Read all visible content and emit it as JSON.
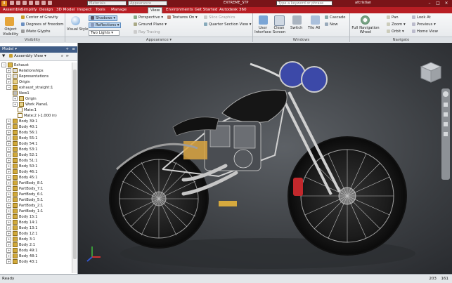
{
  "title_bar": {
    "project_combo": "Materials",
    "appearance_combo": "Appearance",
    "document": "EXTREME_STP",
    "search_placeholder": "Type a keyword or phrase",
    "user": "afcristian"
  },
  "tabs": [
    "Assemble",
    "Simplify",
    "Design",
    "3D Model",
    "Inspect",
    "Tools",
    "Manage",
    "View",
    "Environments",
    "Get Started",
    "Autodesk 360"
  ],
  "active_tab": "View",
  "ribbon": {
    "visibility": {
      "object_visibility": "Object Visibility",
      "center_of_gravity": "Center of Gravity",
      "degrees_of_freedom": "Degrees of Freedom",
      "imate_glyphs": "iMate Glyphs",
      "panel": "Visibility"
    },
    "appearance": {
      "visual_style": "Visual Style",
      "shadows": "Shadows",
      "reflections": "Reflections",
      "lighting": "Two Lights",
      "perspective": "Perspective",
      "ground_plane": "Ground Plane",
      "ray_tracing": "Ray Tracing",
      "textures": "Textures On",
      "slice_graphics": "Slice Graphics",
      "quarter_section": "Quarter Section View",
      "panel": "Appearance"
    },
    "windows": {
      "user_interface": "User Interface",
      "clean_screen": "Clean Screen",
      "switch": "Switch",
      "tile_all": "Tile All",
      "cascade": "Cascade",
      "new": "New",
      "panel": "Windows"
    },
    "navigate": {
      "full_navigation_wheel": "Full Navigation Wheel",
      "pan": "Pan",
      "zoom": "Zoom",
      "orbit": "Orbit",
      "look_at": "Look At",
      "previous": "Previous",
      "home_view": "Home View",
      "panel": "Navigate"
    }
  },
  "browser": {
    "header": "Model",
    "view": "Assembly View",
    "tree": [
      "Exhaust",
      "Relationships",
      "Representations",
      "Origin",
      "exhaust_straight:1",
      "New1",
      "Origin",
      "Work Plane1",
      "Mate:1",
      "Mate:2 (-1.000 in)",
      "Body 39:1",
      "Body 40:1",
      "Body 56:1",
      "Body 55:1",
      "Body 54:1",
      "Body 53:1",
      "Body 52:1",
      "Body 51:1",
      "Body 50:1",
      "Body 46:1",
      "Body 45:1",
      "PartBody_8:1",
      "PartBody_7:1",
      "PartBody_6:1",
      "PartBody_5:1",
      "PartBody_2:1",
      "PartBody_1:1",
      "Body 15:1",
      "Body 14:1",
      "Body 13:1",
      "Body 12:1",
      "Body 3:1",
      "Body 2:1",
      "Body 49:1",
      "Body 48:1",
      "Body 43:1"
    ]
  },
  "status": {
    "left": "Ready",
    "count1": "203",
    "count2": "161"
  },
  "colors": {
    "title_bar": "#7a1418",
    "tab_bar": "#b81e24",
    "browser_header": "#3f5c86"
  }
}
